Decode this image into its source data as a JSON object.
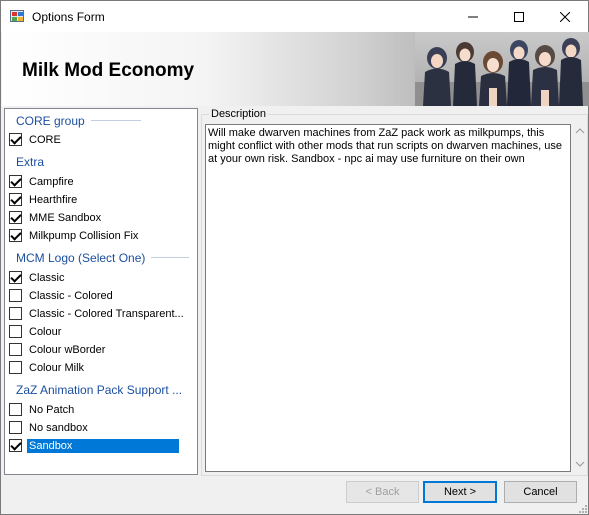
{
  "window": {
    "title": "Options Form",
    "header_title": "Milk Mod Economy"
  },
  "options": {
    "groups": [
      {
        "name": "CORE group",
        "items": [
          {
            "label": "CORE",
            "checked": true
          }
        ]
      },
      {
        "name": "Extra",
        "items": [
          {
            "label": "Campfire",
            "checked": true
          },
          {
            "label": "Hearthfire",
            "checked": true
          },
          {
            "label": "MME Sandbox",
            "checked": true
          },
          {
            "label": "Milkpump Collision Fix",
            "checked": true
          }
        ]
      },
      {
        "name": "MCM Logo (Select One)",
        "items": [
          {
            "label": "Classic",
            "checked": true
          },
          {
            "label": "Classic - Colored",
            "checked": false
          },
          {
            "label": "Classic - Colored Transparent...",
            "checked": false
          },
          {
            "label": "Colour",
            "checked": false
          },
          {
            "label": "Colour wBorder",
            "checked": false
          },
          {
            "label": "Colour Milk",
            "checked": false
          }
        ]
      },
      {
        "name": "ZaZ Animation Pack Support ...",
        "items": [
          {
            "label": "No Patch",
            "checked": false
          },
          {
            "label": "No sandbox",
            "checked": false
          },
          {
            "label": "Sandbox",
            "checked": true,
            "selected": true
          }
        ]
      }
    ]
  },
  "description": {
    "caption": "Description",
    "text": "Will make dwarven machines from ZaZ pack work as milkpumps, this might conflict with other mods that run scripts on dwarven machines, use at your own risk. Sandbox - npc ai may use furniture on their own"
  },
  "buttons": {
    "back": "< Back",
    "next": "Next >",
    "cancel": "Cancel"
  },
  "colors": {
    "group_header": "#1b4fa0",
    "selection": "#0078d7"
  }
}
